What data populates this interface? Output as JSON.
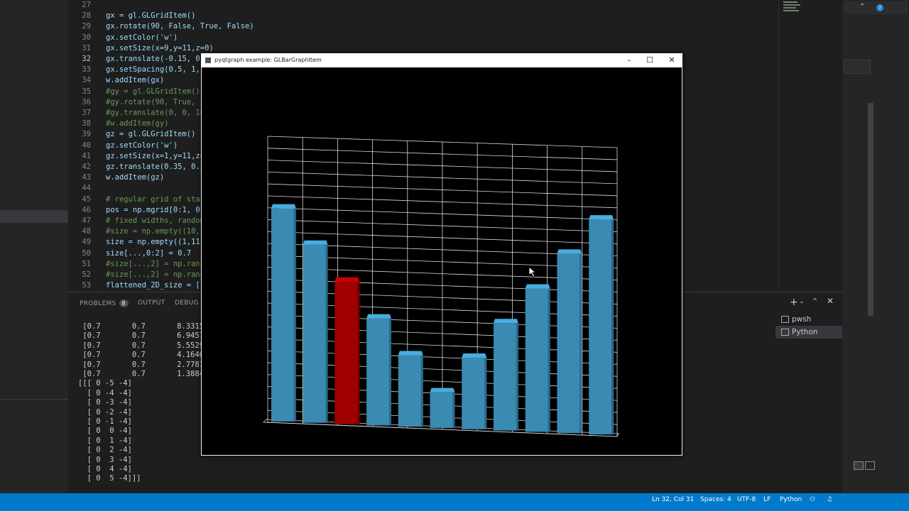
{
  "editor": {
    "current_line": "32",
    "lines": [
      {
        "n": "27",
        "code": ""
      },
      {
        "n": "28",
        "code": "gx = gl.GLGridItem()"
      },
      {
        "n": "29",
        "code": "gx.rotate(90, False, True, False)"
      },
      {
        "n": "30",
        "code": "gx.setColor('w')"
      },
      {
        "n": "31",
        "code": "gx.setSize(x=9,y=11,z=0)"
      },
      {
        "n": "32",
        "code": "gx.translate(-0.15, 0."
      },
      {
        "n": "33",
        "code": "gx.setSpacing(0.5, 1,"
      },
      {
        "n": "34",
        "code": "w.addItem(gx)"
      },
      {
        "n": "35",
        "code": "#gy = gl.GLGridItem()"
      },
      {
        "n": "36",
        "code": "#gy.rotate(90, True, F"
      },
      {
        "n": "37",
        "code": "#gy.translate(0, 0, 10"
      },
      {
        "n": "38",
        "code": "#w.addItem(gy)"
      },
      {
        "n": "39",
        "code": "gz = gl.GLGridItem()"
      },
      {
        "n": "40",
        "code": "gz.setColor('w')"
      },
      {
        "n": "41",
        "code": "gz.setSize(x=1,y=11,z="
      },
      {
        "n": "42",
        "code": "gz.translate(0.35, 0.3"
      },
      {
        "n": "43",
        "code": "w.addItem(gz)"
      },
      {
        "n": "44",
        "code": ""
      },
      {
        "n": "45",
        "code": "# regular grid of star"
      },
      {
        "n": "46",
        "code": "pos = np.mgrid[0:1, 0:"
      },
      {
        "n": "47",
        "code": "# fixed widths, random"
      },
      {
        "n": "48",
        "code": "#size = np.empty((10,1"
      },
      {
        "n": "49",
        "code": "size = np.empty((1,11,"
      },
      {
        "n": "50",
        "code": "size[...,0:2] = 0.7"
      },
      {
        "n": "51",
        "code": "#size[...,2] = np.rand"
      },
      {
        "n": "52",
        "code": "#size[...,2] = np.rand"
      },
      {
        "n": "53",
        "code": "flattened_2D_size = [("
      }
    ]
  },
  "panel": {
    "tabs": {
      "problems": "PROBLEMS",
      "problems_count": "8",
      "output": "OUTPUT",
      "debug": "DEBUG C"
    },
    "terminal_lines": [
      " [0.7       0.7       8.3315",
      " [0.7       0.7       6.9457",
      " [0.7       0.7       5.5529",
      " [0.7       0.7       4.1646",
      " [0.7       0.7       2.7781",
      " [0.7       0.7       1.3884",
      "[[[ 0 -5 -4]",
      "  [ 0 -4 -4]",
      "  [ 0 -3 -4]",
      "  [ 0 -2 -4]",
      "  [ 0 -1 -4]",
      "  [ 0  0 -4]",
      "  [ 0  1 -4]",
      "  [ 0  2 -4]",
      "  [ 0  3 -4]",
      "  [ 0  4 -4]",
      "  [ 0  5 -4]]]"
    ],
    "terminals": [
      "pwsh",
      "Python"
    ]
  },
  "status": {
    "position": "Ln 32, Col 31",
    "spaces": "Spaces: 4",
    "encoding": "UTF-8",
    "eol": "LF",
    "language": "Python"
  },
  "window": {
    "title": "pyqtgraph example: GLBarGraphItem",
    "bars": [
      {
        "value": 0.8315,
        "color": "#3a8ab2"
      },
      {
        "value": 0.6946,
        "color": "#3a8ab2"
      },
      {
        "value": 0.5553,
        "color": "#a00000"
      },
      {
        "value": 0.4165,
        "color": "#3a8ab2"
      },
      {
        "value": 0.2778,
        "color": "#3a8ab2"
      },
      {
        "value": 0.1388,
        "color": "#3a8ab2"
      },
      {
        "value": 0.2778,
        "color": "#3a8ab2"
      },
      {
        "value": 0.4165,
        "color": "#3a8ab2"
      },
      {
        "value": 0.5553,
        "color": "#3a8ab2"
      },
      {
        "value": 0.6946,
        "color": "#3a8ab2"
      },
      {
        "value": 0.8315,
        "color": "#3a8ab2"
      }
    ]
  },
  "colors": {
    "accent": "#007acc",
    "bar": "#3a8ab2",
    "highlight_bar": "#a00000"
  }
}
